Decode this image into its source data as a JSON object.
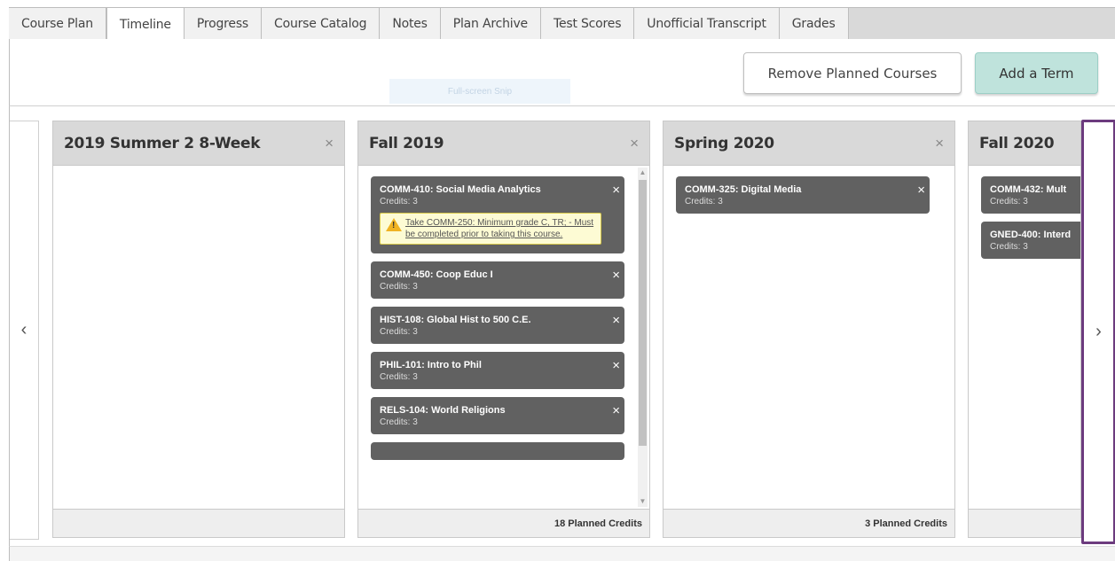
{
  "tabs": [
    {
      "label": "Course Plan"
    },
    {
      "label": "Timeline",
      "active": true
    },
    {
      "label": "Progress"
    },
    {
      "label": "Course Catalog"
    },
    {
      "label": "Notes"
    },
    {
      "label": "Plan Archive"
    },
    {
      "label": "Test Scores"
    },
    {
      "label": "Unofficial Transcript"
    },
    {
      "label": "Grades"
    }
  ],
  "toolbar": {
    "remove_label": "Remove Planned Courses",
    "add_label": "Add a Term",
    "snip_text": "Full-screen Snip"
  },
  "nav": {
    "left_glyph": "‹",
    "right_glyph": "›"
  },
  "close_glyph": "×",
  "terms": [
    {
      "title": "2019 Summer 2 8-Week",
      "footer": "",
      "courses": []
    },
    {
      "title": "Fall 2019",
      "footer": "18 Planned Credits",
      "courses": [
        {
          "title": "COMM-410: Social Media Analytics",
          "credits": "Credits: 3",
          "warning": "Take COMM-250: Minimum grade C, TR; - Must be completed prior to taking this course."
        },
        {
          "title": "COMM-450: Coop Educ I",
          "credits": "Credits: 3"
        },
        {
          "title": "HIST-108: Global Hist to 500 C.E.",
          "credits": "Credits: 3"
        },
        {
          "title": "PHIL-101: Intro to Phil",
          "credits": "Credits: 3"
        },
        {
          "title": "RELS-104: World Religions",
          "credits": "Credits: 3"
        }
      ]
    },
    {
      "title": "Spring 2020",
      "footer": "3 Planned Credits",
      "courses": [
        {
          "title": "COMM-325: Digital Media",
          "credits": "Credits: 3"
        }
      ]
    },
    {
      "title": "Fall 2020",
      "footer": "",
      "courses": [
        {
          "title": "COMM-432: Mult",
          "credits": "Credits: 3"
        },
        {
          "title": "GNED-400: Interd",
          "credits": "Credits: 3"
        }
      ]
    }
  ],
  "colors": {
    "course_card": "#616161",
    "add_button": "#bfe3dc",
    "focus_border": "#6c3b7e",
    "warning_bg": "#fdfbd4",
    "warning_icon": "#f0b323"
  },
  "icons": {
    "warning": "warning-triangle-icon",
    "remove": "close-icon",
    "prev": "chevron-left-icon",
    "next": "chevron-right-icon"
  }
}
